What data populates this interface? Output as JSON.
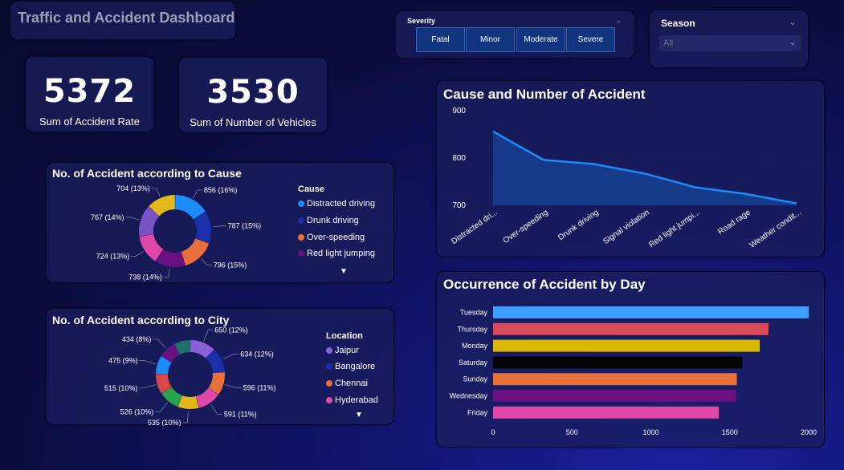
{
  "dashboard_title": "Traffic and Accident Dashboard",
  "kpis": [
    {
      "value": "5372",
      "label": "Sum of Accident Rate"
    },
    {
      "value": "3530",
      "label": "Sum of Number of  Vehicles"
    }
  ],
  "severity_slicer": {
    "header": "Severity",
    "options": [
      "Fatal",
      "Minor",
      "Moderate",
      "Severe"
    ]
  },
  "season_slicer": {
    "header": "Season",
    "selected": "All"
  },
  "icons": {
    "chevron": "chevron-down-icon",
    "more": "caret-down-icon"
  },
  "colors": {
    "accent_blue": "#1a8cff",
    "panel": "#1a1e5c"
  },
  "cause_donut": {
    "title": "No. of Accident according to Cause",
    "legend_title": "Cause",
    "legend": [
      {
        "name": "Distracted driving",
        "color": "#1d8cf8"
      },
      {
        "name": "Drunk driving",
        "color": "#1a2fa8"
      },
      {
        "name": "Over-speeding",
        "color": "#e8703a"
      },
      {
        "name": "Red light jumping",
        "color": "#6a1080"
      }
    ]
  },
  "city_donut": {
    "title": "No. of Accident according to City",
    "legend_title": "Location",
    "legend": [
      {
        "name": "Jaipur",
        "color": "#8b5fd6"
      },
      {
        "name": "Bangalore",
        "color": "#1a2fa8"
      },
      {
        "name": "Chennai",
        "color": "#e8703a"
      },
      {
        "name": "Hyderabad",
        "color": "#e048a8"
      }
    ]
  },
  "line_chart_title": "Cause and Number of Accident",
  "bar_chart_title": "Occurrence of Accident by Day",
  "chart_data": [
    {
      "type": "pie",
      "title": "No. of Accident according to Cause",
      "categories": [
        "Distracted driving",
        "Drunk driving",
        "Over-speeding",
        "Red light jumping",
        "",
        "",
        ""
      ],
      "values": [
        856,
        787,
        796,
        738,
        724,
        767,
        704
      ],
      "labels": [
        "856 (16%)",
        "787 (15%)",
        "796 (15%)",
        "738 (14%)",
        "724 (13%)",
        "767 (14%)",
        "704 (13%)"
      ],
      "colors": [
        "#1d8cf8",
        "#1a2fa8",
        "#e8703a",
        "#6a1080",
        "#e048a8",
        "#7a52c8",
        "#e0b818"
      ]
    },
    {
      "type": "pie",
      "title": "No. of Accident according to City",
      "categories": [
        "Jaipur",
        "Bangalore",
        "Chennai",
        "Hyderabad",
        "",
        "",
        "",
        "",
        "",
        ""
      ],
      "values": [
        650,
        634,
        596,
        591,
        535,
        526,
        515,
        475,
        434,
        420
      ],
      "labels": [
        "650 (12%)",
        "634 (12%)",
        "596 (11%)",
        "591 (11%)",
        "535 (10%)",
        "526 (10%)",
        "515 (10%)",
        "475 (9%)",
        "434 (8%)",
        ""
      ],
      "colors": [
        "#8b5fd6",
        "#1a2fa8",
        "#e8703a",
        "#e048a8",
        "#e0b818",
        "#2aa44a",
        "#d84848",
        "#1d8cf8",
        "#6a1080",
        "#1e7070"
      ]
    },
    {
      "type": "area",
      "title": "Cause and Number of Accident",
      "categories": [
        "Distracted dri...",
        "Over-speeding",
        "Drunk driving",
        "Signal violation",
        "Red light jumpi...",
        "Road rage",
        "Weather condit..."
      ],
      "values": [
        856,
        796,
        787,
        767,
        738,
        724,
        704
      ],
      "ylim": [
        700,
        900
      ],
      "yticks": [
        700,
        800,
        900
      ]
    },
    {
      "type": "bar",
      "title": "Occurrence of Accident by Day",
      "categories": [
        "Tuesday",
        "Thursday",
        "Monday",
        "Saturday",
        "Sunday",
        "Wednesday",
        "Friday"
      ],
      "values": [
        2000,
        1745,
        1690,
        1580,
        1545,
        1540,
        1430
      ],
      "colors": [
        "#3d9eff",
        "#d84a58",
        "#d9b800",
        "#050505",
        "#e8703a",
        "#6a1080",
        "#e048a8"
      ],
      "xlim": [
        0,
        2000
      ],
      "xticks": [
        0,
        500,
        1000,
        1500,
        2000
      ]
    }
  ]
}
